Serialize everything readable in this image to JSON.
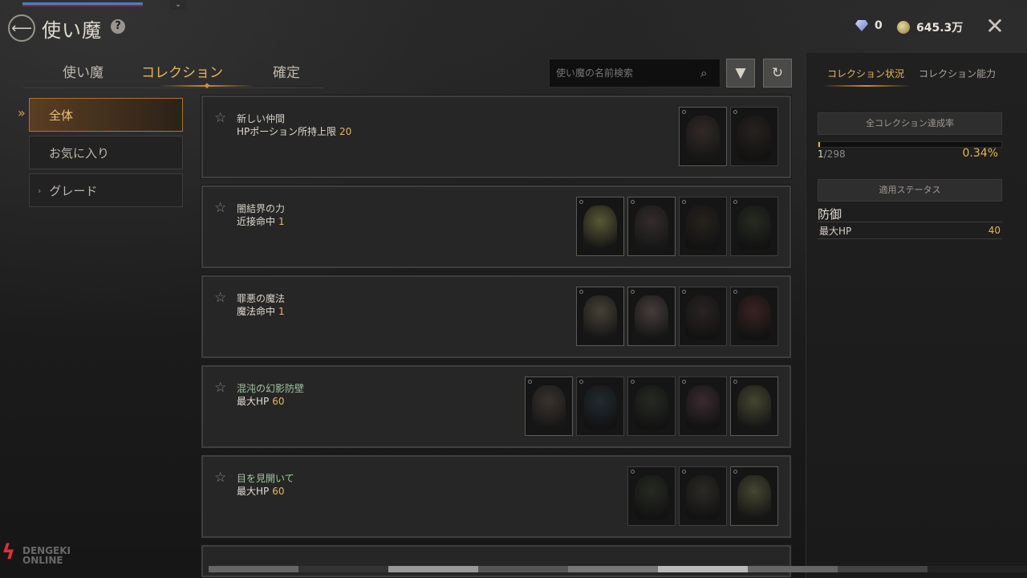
{
  "header": {
    "title": "使い魔",
    "help_label": "?",
    "back_label": "⟵",
    "close_label": "✕",
    "gem_count": "0",
    "gold_amount": "645.3万"
  },
  "tabs": [
    {
      "label": "使い魔",
      "active": false
    },
    {
      "label": "コレクション",
      "active": true
    },
    {
      "label": "確定",
      "active": false
    }
  ],
  "search": {
    "placeholder": "使い魔の名前検索",
    "filter_label": "▼",
    "refresh_label": "↻"
  },
  "filters": [
    {
      "label": "全体",
      "active": true
    },
    {
      "label": "お気に入り",
      "active": false
    },
    {
      "label": "グレード",
      "active": false
    }
  ],
  "collections": [
    {
      "name": "新しい仲間",
      "stat": "HPポーション所持上限",
      "value": "20",
      "name_color": "normal",
      "slots": [
        {
          "color": "#2a2220",
          "owned": true,
          "icon": "eye-orb"
        },
        {
          "color": "#26221e",
          "owned": false,
          "icon": "hooded-creature"
        }
      ]
    },
    {
      "name": "闇結界の力",
      "stat": "近接命中",
      "value": "1",
      "name_color": "normal",
      "slots": [
        {
          "color": "#4a4a2c",
          "owned": true,
          "icon": "treant"
        },
        {
          "color": "#2c2424",
          "owned": true,
          "icon": "eye-orb"
        },
        {
          "color": "#26221c",
          "owned": false,
          "icon": "imp"
        },
        {
          "color": "#262b20",
          "owned": false,
          "icon": "goblin"
        }
      ]
    },
    {
      "name": "罪悪の魔法",
      "stat": "魔法命中",
      "value": "1",
      "name_color": "normal",
      "slots": [
        {
          "color": "#3a362c",
          "owned": true,
          "icon": "ram-beast"
        },
        {
          "color": "#3a3230",
          "owned": true,
          "icon": "rabbit-mage"
        },
        {
          "color": "#2c2222",
          "owned": false,
          "icon": "ghoul"
        },
        {
          "color": "#3a2220",
          "owned": false,
          "icon": "red-goblin"
        }
      ]
    },
    {
      "name": "混沌の幻影防壁",
      "stat": "最大HP",
      "value": "60",
      "name_color": "green",
      "slots": [
        {
          "color": "#2f2a26",
          "owned": true,
          "icon": "dark-knight"
        },
        {
          "color": "#202a30",
          "owned": false,
          "icon": "blue-beast"
        },
        {
          "color": "#262a22",
          "owned": false,
          "icon": "moss-golem"
        },
        {
          "color": "#3a2a30",
          "owned": false,
          "icon": "pink-specter"
        },
        {
          "color": "#3a3a28",
          "owned": true,
          "icon": "toad-beast"
        }
      ]
    },
    {
      "name": "目を見開いて",
      "stat": "最大HP",
      "value": "60",
      "name_color": "green",
      "slots": [
        {
          "color": "#262a22",
          "owned": false,
          "icon": "moss-golem"
        },
        {
          "color": "#2c2a24",
          "owned": false,
          "icon": "horned-demon"
        },
        {
          "color": "#3a3a28",
          "owned": true,
          "icon": "toad-beast"
        }
      ]
    }
  ],
  "right_panel": {
    "tab_status": "コレクション状況",
    "tab_ability": "コレクション能力",
    "achievement_header": "全コレクション達成率",
    "progress_current": "1",
    "progress_total": "/298",
    "progress_percent": "0.34%",
    "progress_fraction": 0.0034,
    "applied_header": "適用ステータス",
    "section_title": "防御",
    "stat_label": "最大HP",
    "stat_value": "40"
  },
  "watermark": {
    "line1": "DENGEKI",
    "line2": "ONLINE"
  },
  "colors": {
    "accent": "#e6b45a",
    "green_name": "#9fc79a",
    "bg": "#1a1a1a"
  }
}
